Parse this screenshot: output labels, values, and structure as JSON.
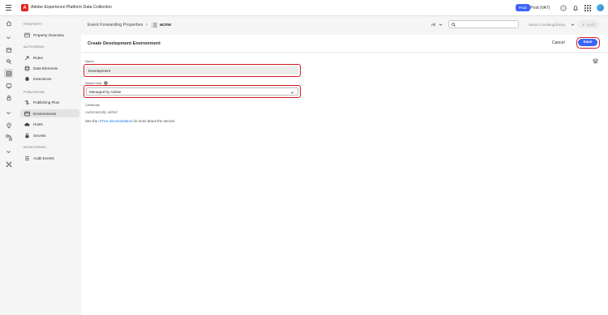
{
  "app": {
    "title": "Adobe Experience Platform Data Collection",
    "logo_letter": "A",
    "env_badge": "Prod",
    "org_label": "Prod (VA7)"
  },
  "sidebar": {
    "sections": [
      {
        "label": "PROPERTY",
        "items": [
          {
            "label": "Property Overview",
            "icon": "property-icon"
          }
        ]
      },
      {
        "label": "AUTHORING",
        "items": [
          {
            "label": "Rules",
            "icon": "rules-icon"
          },
          {
            "label": "Data Elements",
            "icon": "data-elements-icon"
          },
          {
            "label": "Extensions",
            "icon": "extensions-icon"
          }
        ]
      },
      {
        "label": "PUBLISHING",
        "items": [
          {
            "label": "Publishing Flow",
            "icon": "publishing-flow-icon"
          },
          {
            "label": "Environments",
            "icon": "environments-icon",
            "active": true
          },
          {
            "label": "Hosts",
            "icon": "hosts-icon"
          },
          {
            "label": "Secrets",
            "icon": "secrets-icon"
          }
        ]
      },
      {
        "label": "MONITORING",
        "items": [
          {
            "label": "Audit Events",
            "icon": "audit-events-icon"
          }
        ]
      }
    ]
  },
  "header": {
    "breadcrumb_parent": "Event Forwarding Properties",
    "breadcrumb_separator": "›",
    "breadcrumb_current": "acme",
    "filter_value": "All",
    "search_placeholder": "",
    "library_placeholder": "Select a working library",
    "build_label": "Build"
  },
  "form": {
    "title": "Create Development Environment",
    "cancel_label": "Cancel",
    "save_label": "Save",
    "name_label": "Name",
    "name_value": "Development",
    "host_label": "Select Host",
    "host_value": "Managed by Adobe",
    "certificate_label": "Certificate",
    "certificate_value": "Automatically added",
    "help_prefix": "See the",
    "help_link": "mTLS documentation",
    "help_suffix": "for more about the service."
  },
  "colors": {
    "accent": "#3b63fb",
    "highlight": "#d7161e",
    "brand": "#e1251b",
    "link": "#1473e6"
  }
}
